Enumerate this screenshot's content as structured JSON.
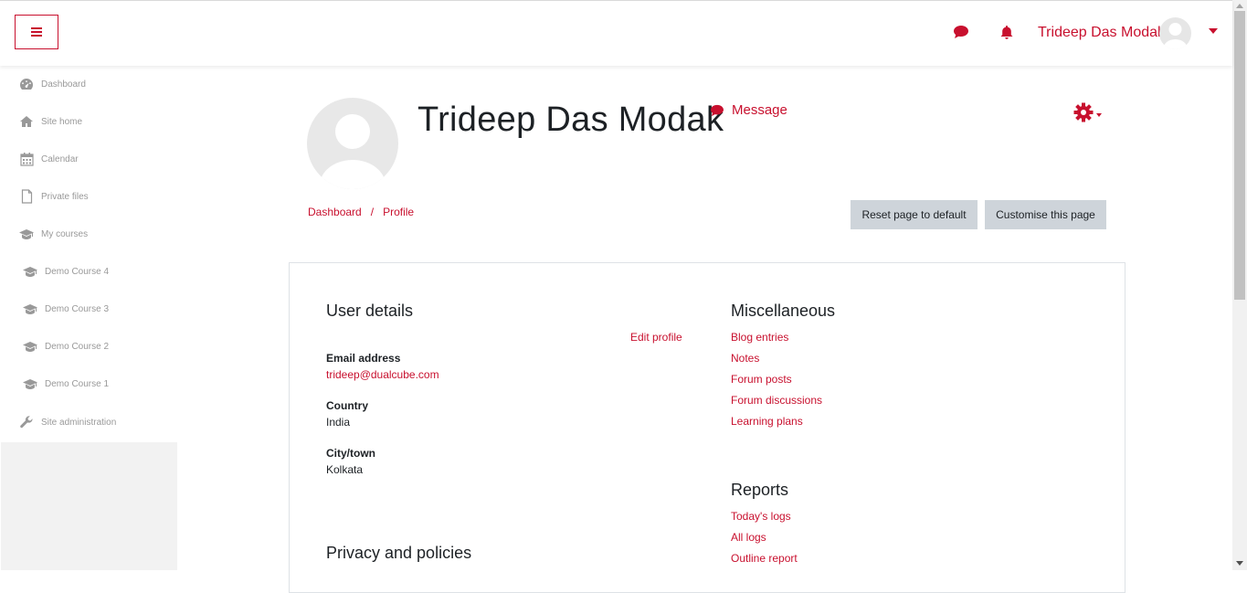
{
  "header": {
    "user_name": "Trideep Das Modak",
    "accent_color": "#c8102e",
    "icons": [
      "menu-icon",
      "message-icon",
      "notification-bell-icon",
      "user-avatar",
      "chevron-down-icon"
    ]
  },
  "sidebar": {
    "items": [
      {
        "label": "Dashboard",
        "icon": "dashboard-icon"
      },
      {
        "label": "Site home",
        "icon": "home-icon"
      },
      {
        "label": "Calendar",
        "icon": "calendar-icon"
      },
      {
        "label": "Private files",
        "icon": "file-icon"
      },
      {
        "label": "My courses",
        "icon": "graduation-cap-icon"
      },
      {
        "label": "Demo Course 4",
        "icon": "graduation-cap-icon"
      },
      {
        "label": "Demo Course 3",
        "icon": "graduation-cap-icon"
      },
      {
        "label": "Demo Course 2",
        "icon": "graduation-cap-icon"
      },
      {
        "label": "Demo Course 1",
        "icon": "graduation-cap-icon"
      },
      {
        "label": "Site administration",
        "icon": "wrench-icon"
      }
    ]
  },
  "profile": {
    "name": "Trideep Das Modak",
    "message_label": "Message"
  },
  "breadcrumb": [
    "Dashboard",
    "Profile"
  ],
  "buttons": {
    "reset": "Reset page to default",
    "customise": "Customise this page"
  },
  "user_details": {
    "title": "User details",
    "edit_profile": "Edit profile",
    "email_label": "Email address",
    "email_value": "trideep@dualcube.com",
    "country_label": "Country",
    "country_value": "India",
    "city_label": "City/town",
    "city_value": "Kolkata"
  },
  "privacy": {
    "title": "Privacy and policies"
  },
  "misc": {
    "title": "Miscellaneous",
    "links": [
      "Blog entries",
      "Notes",
      "Forum posts",
      "Forum discussions",
      "Learning plans"
    ]
  },
  "reports": {
    "title": "Reports",
    "links": [
      "Today's logs",
      "All logs",
      "Outline report"
    ]
  }
}
